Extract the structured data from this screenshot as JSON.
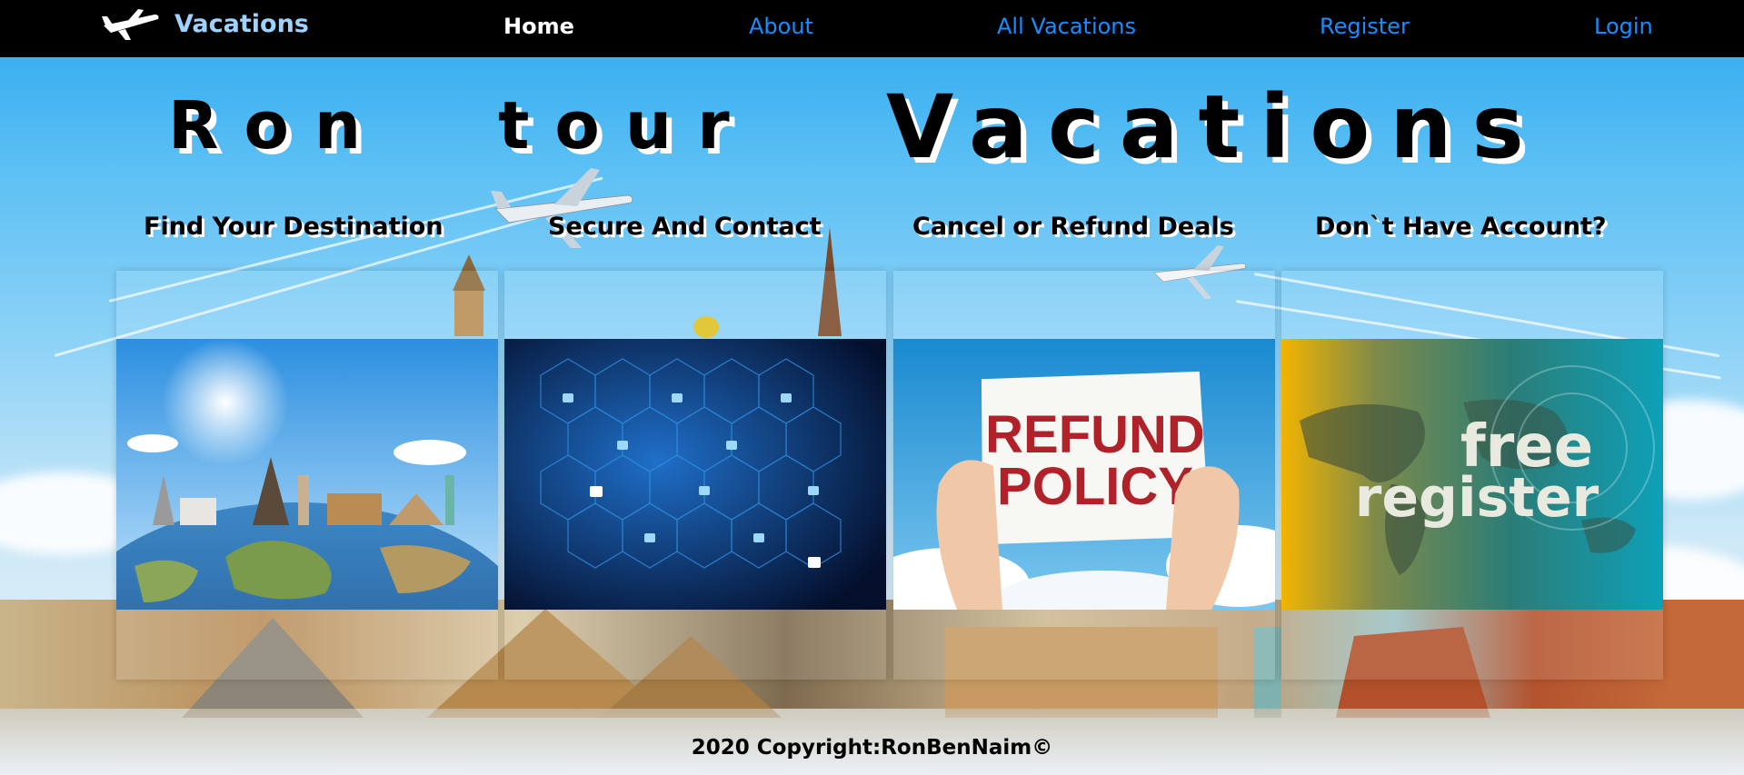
{
  "nav": {
    "brand": "Vacations",
    "brand_icon": "airplane-icon",
    "links": [
      "Home",
      "About",
      "All Vacations",
      "Register",
      "Login"
    ],
    "active": "Home",
    "colors": {
      "bg": "#000000",
      "link": "#1a8cff",
      "active": "#ffffff",
      "brand": "#9fd3ff"
    }
  },
  "hero": {
    "words": [
      "Ron",
      "tour",
      "Vacations"
    ]
  },
  "features": [
    {
      "title": "Find Your Destination",
      "image": "world-landmarks-globe-image"
    },
    {
      "title": "Secure And Contact",
      "image": "security-locks-network-image"
    },
    {
      "title": "Cancel or Refund Deals",
      "image": "refund-policy-sign-image",
      "sign_text": [
        "REFUND",
        "POLICY"
      ]
    },
    {
      "title": "Don`t Have Account?",
      "image": "free-register-world-map-image",
      "overlay_text": [
        "free",
        "register"
      ]
    }
  ],
  "footer": {
    "text": "2020 Copyright:RonBenNaim©"
  }
}
